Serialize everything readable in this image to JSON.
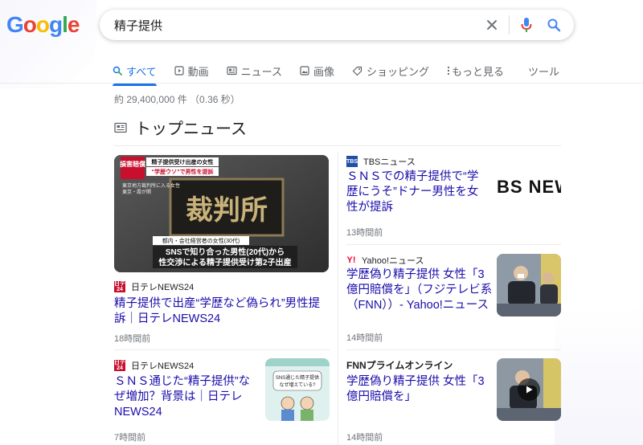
{
  "logo": {
    "text": "Google"
  },
  "search": {
    "query": "精子提供"
  },
  "tabs": [
    {
      "label": "すべて",
      "icon": "search-icon"
    },
    {
      "label": "動画",
      "icon": "video-icon"
    },
    {
      "label": "ニュース",
      "icon": "news-icon"
    },
    {
      "label": "画像",
      "icon": "image-icon"
    },
    {
      "label": "ショッピング",
      "icon": "tag-icon"
    },
    {
      "label": "もっと見る",
      "icon": "more-vert-icon"
    }
  ],
  "tools_label": "ツール",
  "result_stats": "約 29,400,000 件 （0.36 秒）",
  "top_news": {
    "title": "トップニュース"
  },
  "colors": {
    "link": "#1a0dab",
    "accent": "#1a73e8",
    "mic_red": "#ea4335"
  },
  "articles": {
    "a1": {
      "source": "日テレNEWS24",
      "headline": "精子提供で出産“学歴など偽られ”男性提訴｜日テレNEWS24",
      "time": "18時間前",
      "image": {
        "badge": "損害賠償",
        "caption1": "精子提供受け出産の女性",
        "caption2": "“学歴ウソ”で男性を提訴",
        "place1": "東京地方裁判所に入る女性",
        "place2": "東京・霞が関",
        "sign": "裁判所",
        "lower1": "都内・会社経営者の女性(30代)",
        "lower2": "SNSで知り合った男性(20代)から",
        "lower3": "性交渉による精子提供受け第2子出産"
      }
    },
    "a2": {
      "source": "TBSニュース",
      "headline": "ＳＮＳでの精子提供で“学歴にうそ”ドナー男性を女性が提訴",
      "time": "13時間前",
      "thumb_text": "BS NEWS"
    },
    "a3": {
      "source": "Yahoo!ニュース",
      "headline": "学歴偽り精子提供 女性「3億円賠償を」（フジテレビ系（FNN））- Yahoo!ニュース",
      "time": "14時間前"
    },
    "a4": {
      "source": "日テレNEWS24",
      "headline": "ＳＮＳ通じた“精子提供”なぜ増加？背景は｜日テレNEWS24",
      "time": "7時間前",
      "thumb": {
        "bubble1": "SNS通じた精子提供",
        "bubble2": "なぜ増えている?"
      }
    },
    "a5": {
      "source": "FNNプライムオンライン",
      "headline": "学歴偽り精子提供 女性「3億円賠償を」",
      "time": "14時間前"
    }
  }
}
